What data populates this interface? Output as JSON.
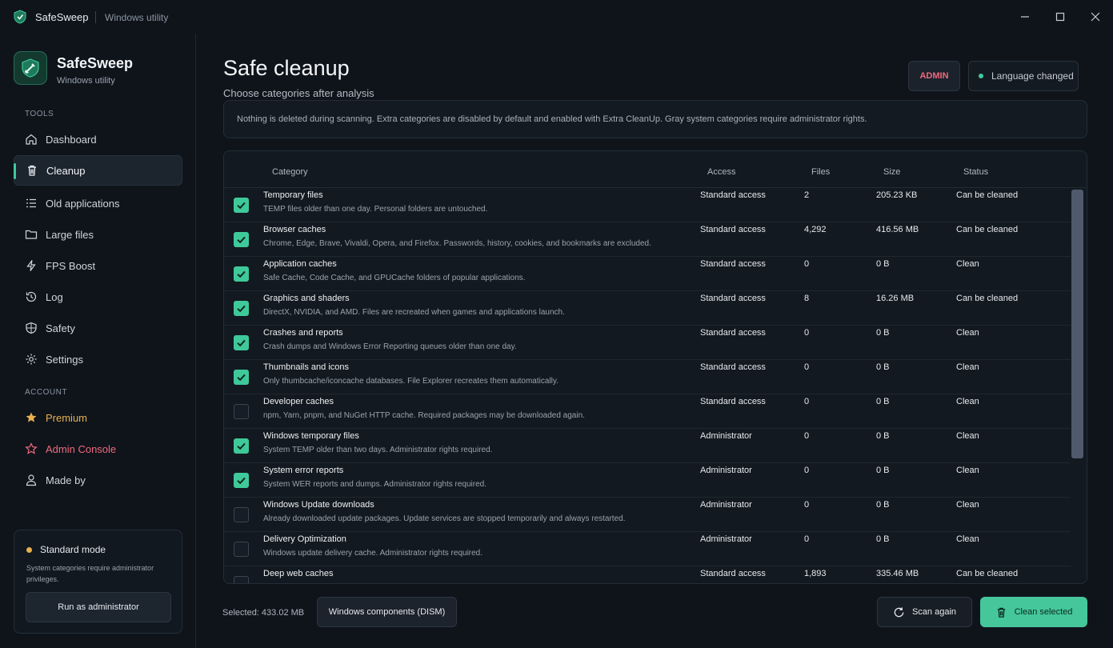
{
  "titlebar": {
    "app_name": "SafeSweep",
    "subtitle": "Windows utility"
  },
  "sidebar": {
    "brand_name": "SafeSweep",
    "brand_sub": "Windows utility",
    "tools_label": "TOOLS",
    "account_label": "ACCOUNT",
    "items": [
      {
        "label": "Dashboard",
        "icon": "home-icon"
      },
      {
        "label": "Cleanup",
        "icon": "trash-icon",
        "active": true
      },
      {
        "label": "Old applications",
        "icon": "list-icon"
      },
      {
        "label": "Large files",
        "icon": "folder-icon"
      },
      {
        "label": "FPS Boost",
        "icon": "lightning-icon"
      },
      {
        "label": "Log",
        "icon": "history-icon"
      },
      {
        "label": "Safety",
        "icon": "shield-icon"
      },
      {
        "label": "Settings",
        "icon": "gear-icon"
      }
    ],
    "account_items": [
      {
        "label": "Premium",
        "icon": "star-icon",
        "color": "#e8b04f"
      },
      {
        "label": "Admin Console",
        "icon": "star-outline-icon",
        "color": "#ef6a7e"
      },
      {
        "label": "Made by",
        "icon": "user-icon"
      }
    ],
    "mode": {
      "title": "Standard mode",
      "description": "System categories require administrator privileges.",
      "run_admin_label": "Run as administrator"
    }
  },
  "header": {
    "title": "Safe cleanup",
    "subtitle": "Choose categories after analysis",
    "admin_badge": "ADMIN",
    "status_pill": "Language changed"
  },
  "info_text": "Nothing is deleted during scanning. Extra categories are disabled by default and enabled with Extra CleanUp. Gray system categories require administrator rights.",
  "table": {
    "columns": [
      "Category",
      "Access",
      "Files",
      "Size",
      "Status"
    ],
    "rows": [
      {
        "checked": true,
        "name": "Temporary files",
        "desc": "TEMP files older than one day. Personal folders are untouched.",
        "access": "Standard access",
        "files": "2",
        "size": "205.23 KB",
        "status": "Can be cleaned"
      },
      {
        "checked": true,
        "name": "Browser caches",
        "desc": "Chrome, Edge, Brave, Vivaldi, Opera, and Firefox. Passwords, history, cookies, and bookmarks are excluded.",
        "access": "Standard access",
        "files": "4,292",
        "size": "416.56 MB",
        "status": "Can be cleaned"
      },
      {
        "checked": true,
        "name": "Application caches",
        "desc": "Safe Cache, Code Cache, and GPUCache folders of popular applications.",
        "access": "Standard access",
        "files": "0",
        "size": "0 B",
        "status": "Clean"
      },
      {
        "checked": true,
        "name": "Graphics and shaders",
        "desc": "DirectX, NVIDIA, and AMD. Files are recreated when games and applications launch.",
        "access": "Standard access",
        "files": "8",
        "size": "16.26 MB",
        "status": "Can be cleaned"
      },
      {
        "checked": true,
        "name": "Crashes and reports",
        "desc": "Crash dumps and Windows Error Reporting queues older than one day.",
        "access": "Standard access",
        "files": "0",
        "size": "0 B",
        "status": "Clean"
      },
      {
        "checked": true,
        "name": "Thumbnails and icons",
        "desc": "Only thumbcache/iconcache databases. File Explorer recreates them automatically.",
        "access": "Standard access",
        "files": "0",
        "size": "0 B",
        "status": "Clean"
      },
      {
        "checked": false,
        "name": "Developer caches",
        "desc": "npm, Yarn, pnpm, and NuGet HTTP cache. Required packages may be downloaded again.",
        "access": "Standard access",
        "files": "0",
        "size": "0 B",
        "status": "Clean"
      },
      {
        "checked": true,
        "name": "Windows temporary files",
        "desc": "System TEMP older than two days. Administrator rights required.",
        "access": "Administrator",
        "files": "0",
        "size": "0 B",
        "status": "Clean"
      },
      {
        "checked": true,
        "name": "System error reports",
        "desc": "System WER reports and dumps. Administrator rights required.",
        "access": "Administrator",
        "files": "0",
        "size": "0 B",
        "status": "Clean"
      },
      {
        "checked": false,
        "name": "Windows Update downloads",
        "desc": "Already downloaded update packages. Update services are stopped temporarily and always restarted.",
        "access": "Administrator",
        "files": "0",
        "size": "0 B",
        "status": "Clean"
      },
      {
        "checked": false,
        "name": "Delivery Optimization",
        "desc": "Windows update delivery cache. Administrator rights required.",
        "access": "Administrator",
        "files": "0",
        "size": "0 B",
        "status": "Clean"
      },
      {
        "checked": false,
        "name": "Deep web caches",
        "desc": "",
        "access": "Standard access",
        "files": "1,893",
        "size": "335.46 MB",
        "status": "Can be cleaned"
      }
    ]
  },
  "footer": {
    "selected": "Selected: 433.02 MB",
    "dism_label": "Windows components (DISM)",
    "scan_label": "Scan again",
    "clean_label": "Clean selected"
  },
  "colors": {
    "accent": "#3fc99a",
    "premium": "#e8b04f",
    "admin": "#ef6a7e",
    "background": "#0f141b"
  }
}
